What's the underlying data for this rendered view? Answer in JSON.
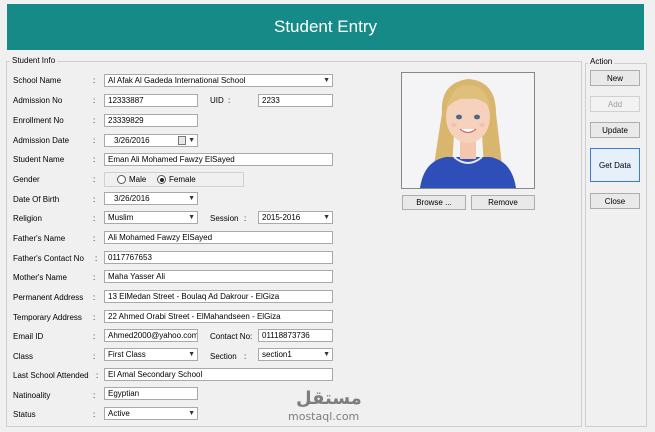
{
  "window": {
    "title": "Student Entry"
  },
  "groups": {
    "student_info": "Student Info",
    "action": "Action"
  },
  "fields": {
    "school_name": {
      "label": "School Name",
      "value": "Al Afak Al Gadeda International School"
    },
    "admission_no": {
      "label": "Admission No",
      "value": "12333887"
    },
    "uid": {
      "label": "UID",
      "value": "2233"
    },
    "enrollment_no": {
      "label": "Enrollment No",
      "value": "23339829"
    },
    "admission_date": {
      "label": "Admission Date",
      "value": "3/26/2016"
    },
    "student_name": {
      "label": "Student Name",
      "value": "Eman Ali Mohamed Fawzy ElSayed"
    },
    "gender": {
      "label": "Gender",
      "options": [
        "Male",
        "Female"
      ],
      "selected": "Female"
    },
    "date_of_birth": {
      "label": "Date Of Birth",
      "value": "3/26/2016"
    },
    "religion": {
      "label": "Religion",
      "value": "Muslim"
    },
    "session": {
      "label": "Session",
      "value": "2015-2016"
    },
    "fathers_name": {
      "label": "Father's Name",
      "value": "Ali Mohamed Fawzy ElSayed"
    },
    "fathers_contact": {
      "label": "Father's Contact No",
      "value": "0117767653"
    },
    "mothers_name": {
      "label": "Mother's Name",
      "value": "Maha Yasser Ali"
    },
    "permanent_address": {
      "label": "Permanent Address",
      "value": "13 ElMedan Street - Boulaq Ad Dakrour - ElGiza"
    },
    "temporary_address": {
      "label": "Temporary Address",
      "value": "22 Ahmed Orabi Street - ElMahandseen - ElGiza"
    },
    "email": {
      "label": "Email ID",
      "value": "Ahmed2000@yahoo.com"
    },
    "contact_no": {
      "label": "Contact No",
      "value": "01118873736"
    },
    "class": {
      "label": "Class",
      "value": "First Class"
    },
    "section": {
      "label": "Section",
      "value": "section1"
    },
    "last_school": {
      "label": "Last School Attended",
      "value": "El Amal Secondary School"
    },
    "nationality": {
      "label": "Natinoality",
      "value": "Egyptian"
    },
    "status": {
      "label": "Status",
      "value": "Active"
    }
  },
  "photo": {
    "browse_label": "Browse ...",
    "remove_label": "Remove"
  },
  "actions": {
    "new": "New",
    "add": "Add",
    "update": "Update",
    "get_data": "Get Data",
    "close": "Close"
  },
  "colon": ":",
  "watermark": {
    "arabic": "مستقل",
    "latin": "mostaql.com"
  },
  "colors": {
    "title_bar": "#168a86",
    "title_text": "#ffffff"
  }
}
